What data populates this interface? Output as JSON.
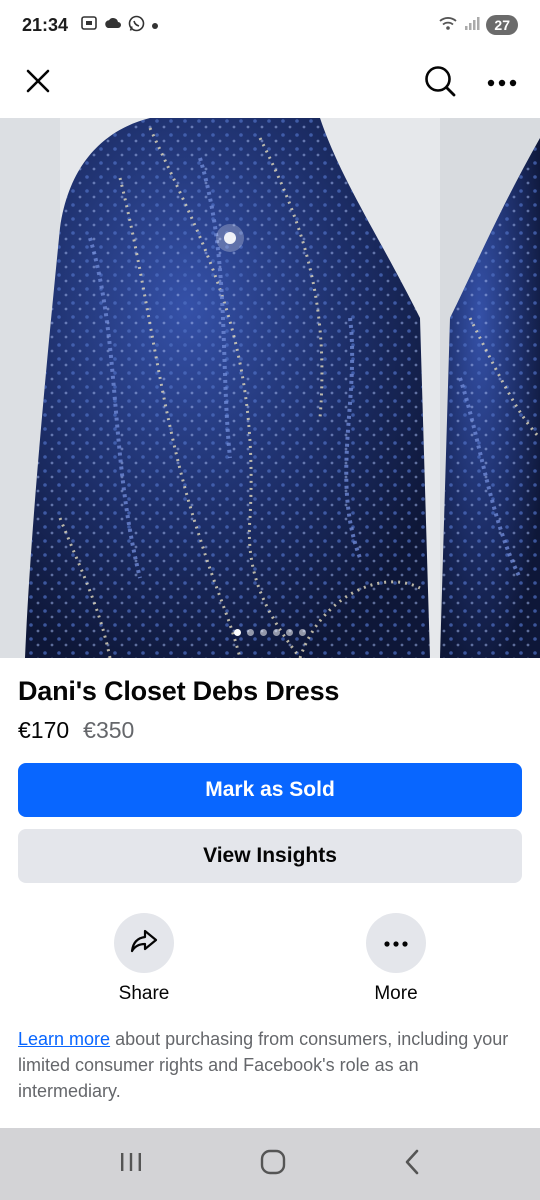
{
  "status_bar": {
    "time": "21:34",
    "left_icons": [
      "screenshot-icon",
      "cloud-icon",
      "whatsapp-icon",
      "dot-icon"
    ],
    "right_icons": [
      "wifi-icon",
      "signal-icon"
    ],
    "battery": "27"
  },
  "top_bar": {
    "close_icon": "close-icon",
    "search_icon": "search-icon",
    "more_icon": "more-horizontal-icon"
  },
  "listing": {
    "photo_description_colors": {
      "dress": "#1b2f6b",
      "background": "#e9ebee"
    },
    "photo_dots_count": 6,
    "photo_active_index": 0,
    "title": "Dani's Closet Debs Dress",
    "price": "€170",
    "original_price": "€350"
  },
  "buttons": {
    "mark_sold": "Mark as Sold",
    "view_insights": "View Insights"
  },
  "actions": {
    "share": {
      "label": "Share",
      "icon": "share-arrow-icon"
    },
    "more": {
      "label": "More",
      "icon": "more-horizontal-icon"
    }
  },
  "disclaimer": {
    "link_text": "Learn more",
    "text": " about purchasing from consumers, including your limited consumer rights and Facebook's role as an intermediary."
  },
  "nav_bar": {
    "recents_icon": "recents-icon",
    "home_icon": "home-icon",
    "back_icon": "back-icon"
  },
  "colors": {
    "primary": "#0866ff",
    "secondary_bg": "#e4e6eb",
    "secondary_text": "#65676b",
    "nav_bg": "#d3d3d6"
  }
}
